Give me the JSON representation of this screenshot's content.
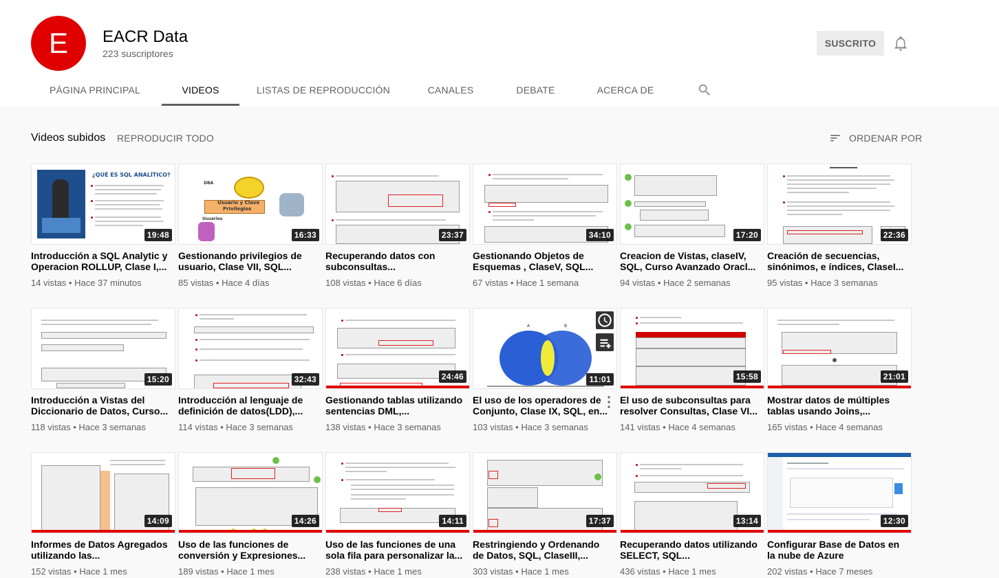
{
  "channel": {
    "avatar_letter": "E",
    "name": "EACR Data",
    "subscribers": "223 suscriptores",
    "subscribe_label": "SUSCRITO",
    "accent": "#e00000"
  },
  "tabs": [
    {
      "label": "PÁGINA PRINCIPAL",
      "active": false
    },
    {
      "label": "VIDEOS",
      "active": true
    },
    {
      "label": "LISTAS DE REPRODUCCIÓN",
      "active": false
    },
    {
      "label": "CANALES",
      "active": false
    },
    {
      "label": "DEBATE",
      "active": false
    },
    {
      "label": "ACERCA DE",
      "active": false
    }
  ],
  "icons": {
    "search": "search-icon",
    "bell": "bell-icon",
    "sort": "sort-icon"
  },
  "section": {
    "title": "Videos subidos",
    "play_all": "REPRODUCIR TODO",
    "sort_label": "ORDENAR POR"
  },
  "videos": [
    {
      "title": "Introducción a SQL Analytic y Operacion ROLLUP, Clase I,...",
      "views": "14 vistas",
      "age": "Hace 37 minutos",
      "duration": "19:48",
      "watched": 0
    },
    {
      "title": "Gestionando privilegios de usuario, Clase VII, SQL...",
      "views": "85 vistas",
      "age": "Hace 4 días",
      "duration": "16:33",
      "watched": 0
    },
    {
      "title": "Recuperando datos con subconsultas...",
      "views": "108 vistas",
      "age": "Hace 6 días",
      "duration": "23:37",
      "watched": 0
    },
    {
      "title": "Gestionando Objetos de Esquemas , ClaseV, SQL...",
      "views": "67 vistas",
      "age": "Hace 1 semana",
      "duration": "34:10",
      "watched": 0
    },
    {
      "title": "Creacion de Vistas, claseIV, SQL, Curso Avanzado Oracl...",
      "views": "94 vistas",
      "age": "Hace 2 semanas",
      "duration": "17:20",
      "watched": 0
    },
    {
      "title": "Creación de secuencias, sinónimos, e índices, ClaseI...",
      "views": "95 vistas",
      "age": "Hace 3 semanas",
      "duration": "22:36",
      "watched": 0
    },
    {
      "title": "Introducción a Vistas del Diccionario de Datos, Curso...",
      "views": "118 vistas",
      "age": "Hace 3 semanas",
      "duration": "15:20",
      "watched": 0
    },
    {
      "title": "Introducción al lenguaje de definición de datos(LDD),...",
      "views": "114 vistas",
      "age": "Hace 3 semanas",
      "duration": "32:43",
      "watched": 0
    },
    {
      "title": "Gestionando tablas utilizando sentencias DML,...",
      "views": "138 vistas",
      "age": "Hace 3 semanas",
      "duration": "24:46",
      "watched": 1
    },
    {
      "title": "El uso de los operadores de Conjunto, Clase IX, SQL, en...",
      "views": "103 vistas",
      "age": "Hace 3 semanas",
      "duration": "11:01",
      "watched": 0
    },
    {
      "title": "El uso de subconsultas para resolver Consultas, Clase VI...",
      "views": "141 vistas",
      "age": "Hace 4 semanas",
      "duration": "15:58",
      "watched": 1
    },
    {
      "title": "Mostrar datos de múltiples tablas usando Joins,...",
      "views": "165 vistas",
      "age": "Hace 4 semanas",
      "duration": "21:01",
      "watched": 1
    },
    {
      "title": "Informes de Datos Agregados utilizando las...",
      "views": "152 vistas",
      "age": "Hace 1 mes",
      "duration": "14:09",
      "watched": 1
    },
    {
      "title": "Uso de las funciones de conversión y Expresiones...",
      "views": "189 vistas",
      "age": "Hace 1 mes",
      "duration": "14:26",
      "watched": 1
    },
    {
      "title": "Uso de las funciones de una sola fila para personalizar la...",
      "views": "238 vistas",
      "age": "Hace 1 mes",
      "duration": "14:11",
      "watched": 1
    },
    {
      "title": "Restringiendo y Ordenando de Datos, SQL, ClaseIII,...",
      "views": "303 vistas",
      "age": "Hace 1 mes",
      "duration": "17:37",
      "watched": 1
    },
    {
      "title": "Recuperando datos utilizando SELECT, SQL...",
      "views": "436 vistas",
      "age": "Hace 1 mes",
      "duration": "13:14",
      "watched": 1
    },
    {
      "title": "Configurar Base de Datos en la nube de Azure",
      "views": "202 vistas",
      "age": "Hace 7 meses",
      "duration": "12:30",
      "watched": 1
    }
  ]
}
